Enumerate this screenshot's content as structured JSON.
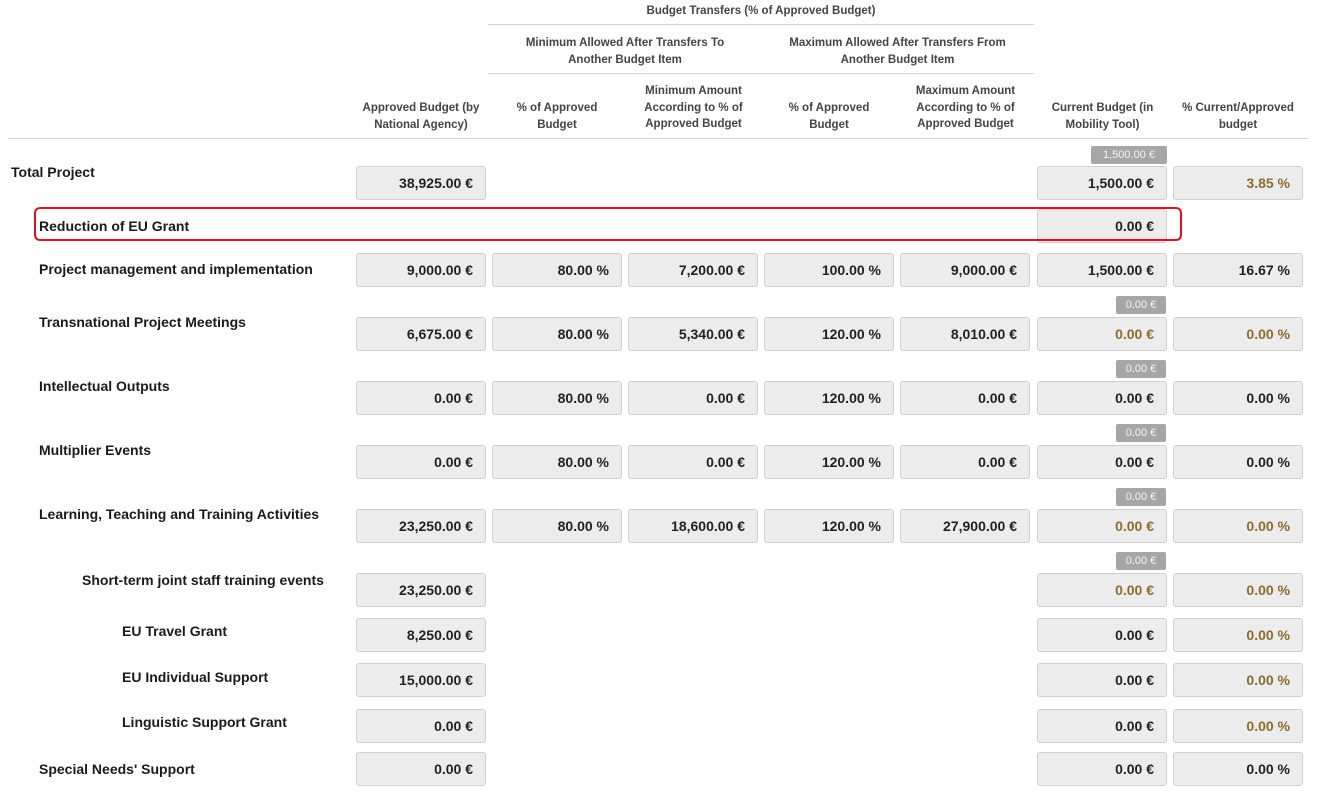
{
  "header": {
    "transfers_group": "Budget Transfers (% of Approved Budget)",
    "min_group": "Minimum Allowed After Transfers To Another Budget Item",
    "max_group": "Maximum Allowed After Transfers From Another Budget Item",
    "approved_budget": "Approved Budget (by National Agency)",
    "min_pct": "% of Approved Budget",
    "min_amount": "Minimum Amount According to % of Approved Budget",
    "max_pct": "% of Approved Budget",
    "max_amount": "Maximum Amount According to % of Approved Budget",
    "current_budget": "Current Budget (in Mobility Tool)",
    "pct_current_approved": "% Current/Approved budget"
  },
  "rows": [
    {
      "label": "Total Project",
      "approved": "38,925.00 €",
      "badge": "1,500.00 €",
      "current": "1,500.00 €",
      "pct_current": "3.85 %"
    },
    {
      "label": "Reduction of EU Grant",
      "current": "0.00 €"
    },
    {
      "label": "Project management and implementation",
      "approved": "9,000.00 €",
      "min_pct": "80.00 %",
      "min_amount": "7,200.00 €",
      "max_pct": "100.00 %",
      "max_amount": "9,000.00 €",
      "current": "1,500.00 €",
      "pct_current": "16.67 %"
    },
    {
      "label": "Transnational Project Meetings",
      "approved": "6,675.00 €",
      "min_pct": "80.00 %",
      "min_amount": "5,340.00 €",
      "max_pct": "120.00 %",
      "max_amount": "8,010.00 €",
      "badge": "0.00 €",
      "current": "0.00 €",
      "pct_current": "0.00 %"
    },
    {
      "label": "Intellectual Outputs",
      "approved": "0.00 €",
      "min_pct": "80.00 %",
      "min_amount": "0.00 €",
      "max_pct": "120.00 %",
      "max_amount": "0.00 €",
      "badge": "0.00 €",
      "current": "0.00 €",
      "pct_current": "0.00 %"
    },
    {
      "label": "Multiplier Events",
      "approved": "0.00 €",
      "min_pct": "80.00 %",
      "min_amount": "0.00 €",
      "max_pct": "120.00 %",
      "max_amount": "0.00 €",
      "badge": "0.00 €",
      "current": "0.00 €",
      "pct_current": "0.00 %"
    },
    {
      "label": "Learning, Teaching and Training Activities",
      "approved": "23,250.00 €",
      "min_pct": "80.00 %",
      "min_amount": "18,600.00 €",
      "max_pct": "120.00 %",
      "max_amount": "27,900.00 €",
      "badge": "0.00 €",
      "current": "0.00 €",
      "pct_current": "0.00 %"
    },
    {
      "label": "Short-term joint staff training events",
      "approved": "23,250.00 €",
      "badge": "0.00 €",
      "current": "0.00 €",
      "pct_current": "0.00 %"
    },
    {
      "label": "EU Travel Grant",
      "approved": "8,250.00 €",
      "current": "0.00 €",
      "pct_current": "0.00 %"
    },
    {
      "label": "EU Individual Support",
      "approved": "15,000.00 €",
      "current": "0.00 €",
      "pct_current": "0.00 %"
    },
    {
      "label": "Linguistic Support Grant",
      "approved": "0.00 €",
      "current": "0.00 €",
      "pct_current": "0.00 %"
    },
    {
      "label": "Special Needs' Support",
      "approved": "0.00 €",
      "current": "0.00 €",
      "pct_current": "0.00 %"
    }
  ],
  "colors": {
    "highlight_border": "#e0101c",
    "gold_value": "#8a6d2c",
    "box_background": "#ececec",
    "badge_background": "#a6a6a6"
  }
}
